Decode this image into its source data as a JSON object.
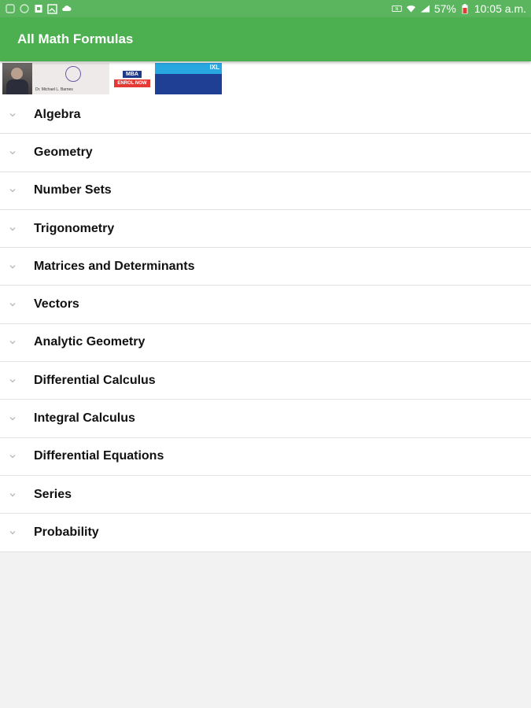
{
  "status_bar": {
    "battery": "57%",
    "time": "10:05 a.m."
  },
  "app_bar": {
    "title": "All Math Formulas"
  },
  "ad": {
    "name": "Dr. Michael L. Barnes",
    "mba": "MBA",
    "enrol": "ENROL NOW",
    "ixl": "IXL"
  },
  "topics": [
    {
      "label": "Algebra"
    },
    {
      "label": "Geometry"
    },
    {
      "label": "Number Sets"
    },
    {
      "label": "Trigonometry"
    },
    {
      "label": "Matrices and Determinants"
    },
    {
      "label": "Vectors"
    },
    {
      "label": "Analytic Geometry"
    },
    {
      "label": "Differential Calculus"
    },
    {
      "label": "Integral Calculus"
    },
    {
      "label": "Differential Equations"
    },
    {
      "label": "Series"
    },
    {
      "label": "Probability"
    }
  ],
  "colors": {
    "status_bar": "#5bb55f",
    "app_bar": "#4caf50",
    "background": "#f2f2f2"
  }
}
